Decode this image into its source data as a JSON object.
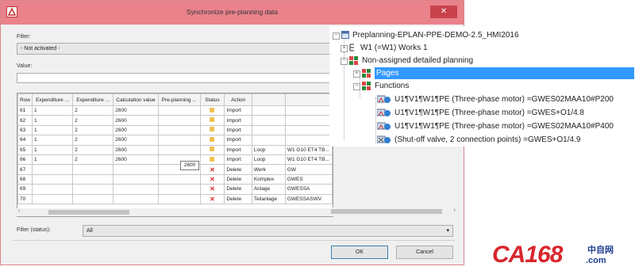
{
  "dialog": {
    "title": "Synchronize pre-planning data",
    "close_glyph": "✕",
    "filter_label": "Filter:",
    "filter_value": "- Not activated -",
    "value_label": "Value:",
    "value_text": "",
    "filter_status_label": "Filter (status):",
    "filter_status_value": "All",
    "ok_label": "OK",
    "cancel_label": "Cancel",
    "tooltip": "2600"
  },
  "grid": {
    "columns": [
      "Row",
      "Expenditure ...",
      "Expenditure ...",
      "Calculation value",
      "Pre-planning ...",
      "Status",
      "Action",
      "",
      ""
    ],
    "rows": [
      {
        "row": "61",
        "e1": "1",
        "e2": "2",
        "calc": "2600",
        "pre": "",
        "status": "warn",
        "action": "Import",
        "c8": "",
        "c9": ""
      },
      {
        "row": "62",
        "e1": "1",
        "e2": "2",
        "calc": "2600",
        "pre": "",
        "status": "warn",
        "action": "Import",
        "c8": "",
        "c9": ""
      },
      {
        "row": "63",
        "e1": "1",
        "e2": "2",
        "calc": "2600",
        "pre": "",
        "status": "warn",
        "action": "Import",
        "c8": "",
        "c9": ""
      },
      {
        "row": "64",
        "e1": "1",
        "e2": "2",
        "calc": "2600",
        "pre": "",
        "status": "warn",
        "action": "Import",
        "c8": "",
        "c9": ""
      },
      {
        "row": "65",
        "e1": "1",
        "e2": "2",
        "calc": "2600",
        "pre": "",
        "status": "warn",
        "action": "Import",
        "c8": "Loop",
        "c9": "W1 G10 ET4 TB..."
      },
      {
        "row": "66",
        "e1": "1",
        "e2": "2",
        "calc": "2600",
        "pre": "",
        "status": "warn",
        "action": "Import",
        "c8": "Loop",
        "c9": "W1 G10 ET4 TB..."
      },
      {
        "row": "67",
        "e1": "",
        "e2": "",
        "calc": "",
        "pre": "",
        "status": "delete",
        "action": "Delete",
        "c8": "Werk",
        "c9": "GW"
      },
      {
        "row": "68",
        "e1": "",
        "e2": "",
        "calc": "",
        "pre": "",
        "status": "delete",
        "action": "Delete",
        "c8": "Komplex",
        "c9": "GWES"
      },
      {
        "row": "69",
        "e1": "",
        "e2": "",
        "calc": "",
        "pre": "",
        "status": "delete",
        "action": "Delete",
        "c8": "Anlage",
        "c9": "GWESSA"
      },
      {
        "row": "70",
        "e1": "",
        "e2": "",
        "calc": "",
        "pre": "",
        "status": "delete",
        "action": "Delete",
        "c8": "Teilanlage",
        "c9": "GWESSASWV"
      }
    ]
  },
  "tree": {
    "root": "Preplanning-EPLAN-PPE-DEMO-2.5_HMI2016",
    "w1": "W1 (=W1) Works 1",
    "non_assigned": "Non-assigned detailed planning",
    "pages": "Pages",
    "functions": "Functions",
    "items": [
      "U1¶V1¶W1¶PE (Three-phase motor) =GWES02MAA10#P200",
      "U1¶V1¶W1¶PE (Three-phase motor) =GWES+O1/4.8",
      "U1¶V1¶W1¶PE (Three-phase motor) =GWES02MAA10#P400",
      "(Shut-off valve, 2 connection points) =GWES+O1/4.9"
    ]
  },
  "logo": {
    "brand": "CA168",
    "domain_suffix": ".com",
    "cn": "中自网"
  },
  "colors": {
    "titlebar": "#e9828b",
    "selection": "#3399ff",
    "delete": "#d62b2b",
    "warn": "#f0c050",
    "logo_red": "#d7262c",
    "logo_blue": "#1e3f8f"
  }
}
